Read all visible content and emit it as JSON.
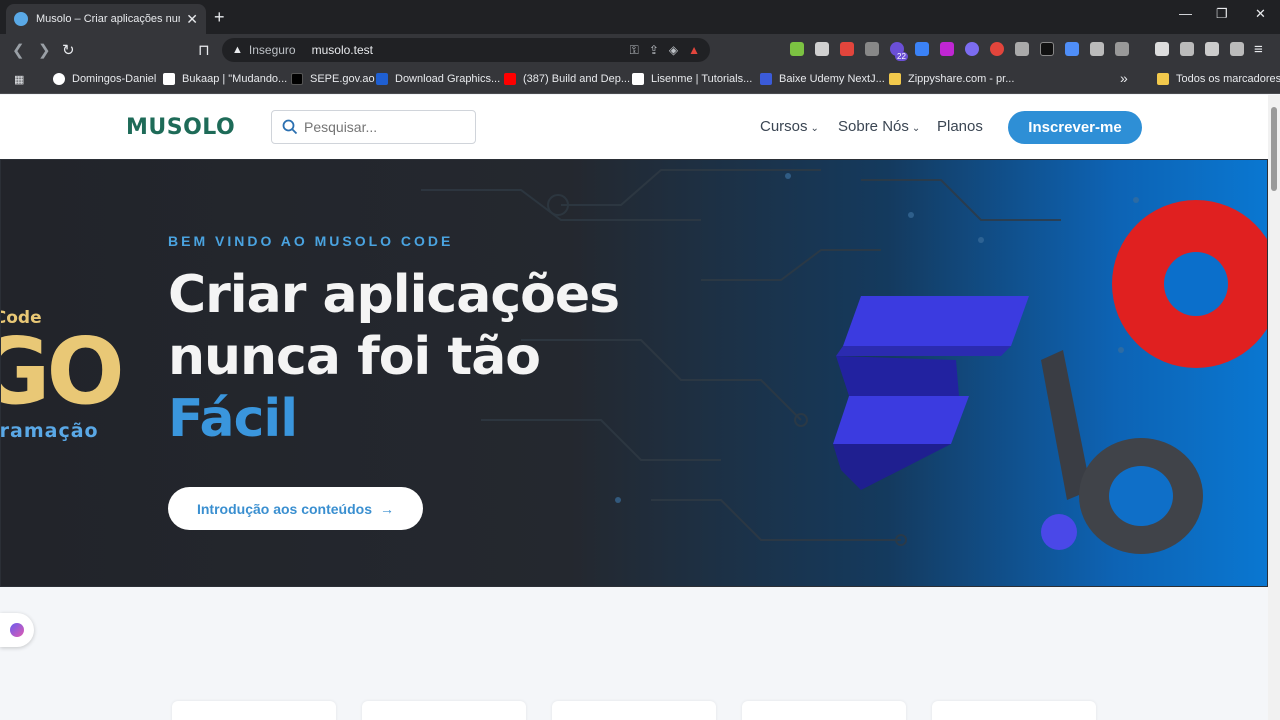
{
  "browser": {
    "tab_title": "Musolo – Criar aplicações nunca",
    "tab_close": "✕",
    "new_tab": "+",
    "window_controls": [
      "—",
      "❐",
      "✕"
    ],
    "omnibox": {
      "insecure_label": "Inseguro",
      "url": "musolo.test"
    },
    "extensions_badge": "22",
    "bookmarks": [
      {
        "label": "Domingos-Daniel",
        "color": "#ffffff"
      },
      {
        "label": "Bukaap | \"Mudando...",
        "color": "#ffffff"
      },
      {
        "label": "SEPE.gov.ao",
        "color": "#000000"
      },
      {
        "label": "Download Graphics...",
        "color": "#1f5fd1"
      },
      {
        "label": "(387) Build and Dep...",
        "color": "#ff0000"
      },
      {
        "label": "Lisenme | Tutorials...",
        "color": "#ffffff"
      },
      {
        "label": "Baixe Udemy NextJ...",
        "color": "#3b5bd9"
      },
      {
        "label": "Zippyshare.com - pr...",
        "color": "#f2c94c"
      }
    ],
    "bookmarks_more": "»",
    "all_bookmarks": "Todos os marcadores"
  },
  "site": {
    "logo": "MUSOLO",
    "search_placeholder": "Pesquisar...",
    "nav": {
      "courses": "Cursos",
      "about": "Sobre Nós",
      "plans": "Planos"
    },
    "signup_label": "Inscrever-me",
    "hero": {
      "eyebrow": "BEM VINDO AO MUSOLO CODE",
      "headline_line1": "Criar aplicações",
      "headline_line2": "nunca foi tão",
      "headline_accent": "Fácil",
      "cta_label": "Introdução aos conteúdos",
      "go_logo": {
        "top": "w-Code",
        "main": "GO",
        "bottom": "ogramação"
      }
    }
  }
}
